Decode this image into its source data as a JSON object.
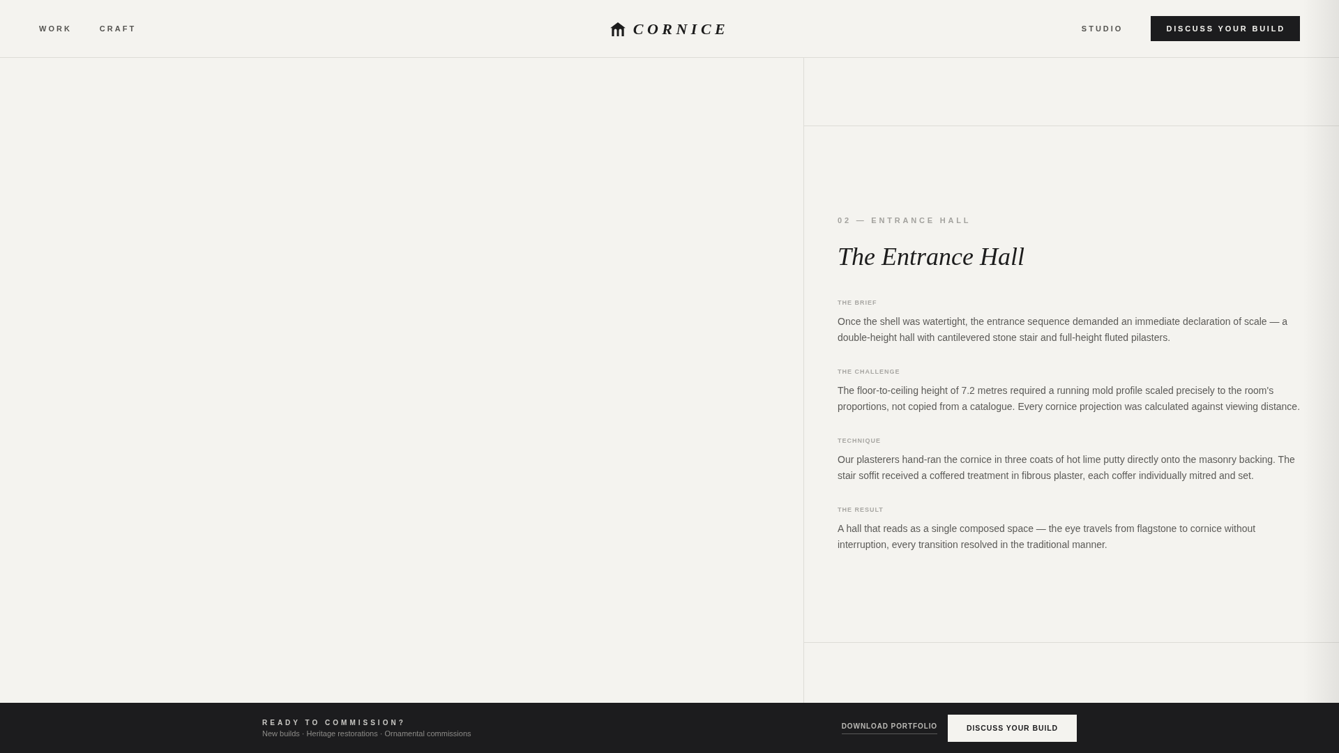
{
  "header": {
    "nav_left": [
      "WORK",
      "CRAFT"
    ],
    "logo": "CORNICE",
    "nav_right": [
      "STUDIO"
    ],
    "cta": "DISCUSS YOUR BUILD"
  },
  "project": {
    "eyebrow": "02 — ENTRANCE HALL",
    "title": "The Entrance Hall",
    "sections": [
      {
        "label": "THE BRIEF",
        "text": "Once the shell was watertight, the entrance sequence demanded an immediate declaration of scale — a double-height hall with cantilevered stone stair and full-height fluted pilasters."
      },
      {
        "label": "THE CHALLENGE",
        "text": "The floor-to-ceiling height of 7.2 metres required a running mold profile scaled precisely to the room's proportions, not copied from a catalogue. Every cornice projection was calculated against viewing distance."
      },
      {
        "label": "TECHNIQUE",
        "text": "Our plasterers hand-ran the cornice in three coats of hot lime putty directly onto the masonry backing. The stair soffit received a coffered treatment in fibrous plaster, each coffer individually mitred and set."
      },
      {
        "label": "THE RESULT",
        "text": "A hall that reads as a single composed space — the eye travels from flagstone to cornice without interruption, every transition resolved in the traditional manner."
      }
    ]
  },
  "footer": {
    "heading": "READY TO COMMISSION?",
    "subtitle": "New builds · Heritage restorations · Ornamental commissions",
    "link": "DOWNLOAD PORTFOLIO",
    "cta": "DISCUSS YOUR BUILD"
  }
}
